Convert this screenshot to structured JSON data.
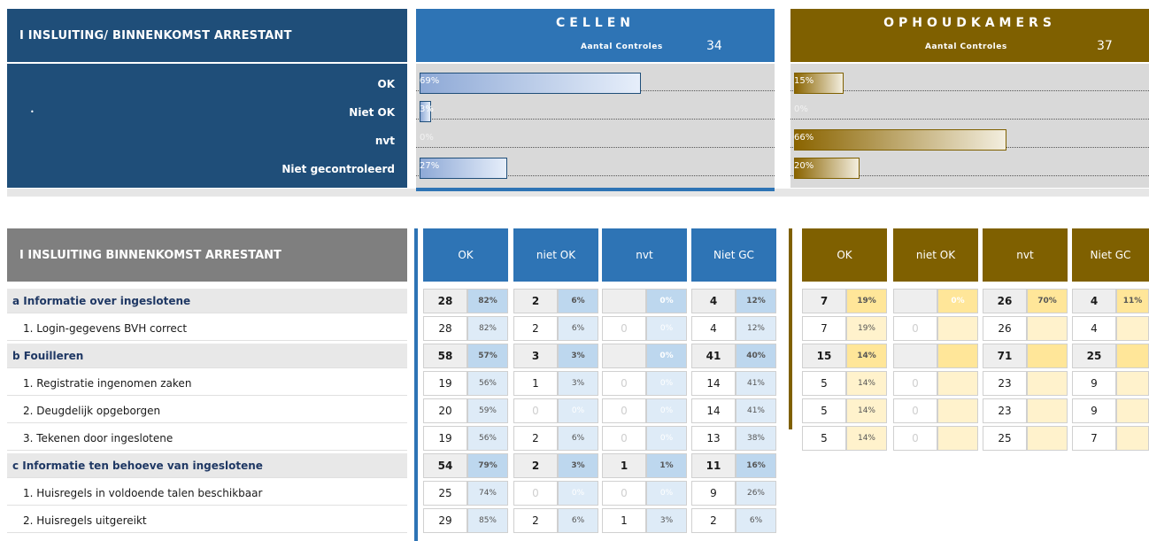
{
  "summary": {
    "title": "I   INSLUITING/ BINNENKOMST ARRESTANT",
    "rows": [
      "OK",
      "Niet OK",
      "nvt",
      "Niet gecontroleerd"
    ],
    "cellen": {
      "name": "CELLEN",
      "count_label": "Aantal Controles",
      "count": "34",
      "color": "#2e74b5",
      "values": [
        0.69,
        0.03,
        0.0,
        0.27
      ],
      "labels": [
        "69%",
        "3%",
        "0%",
        "27%"
      ]
    },
    "ophoudkamers": {
      "name": "OPHOUDKAMERS",
      "count_label": "Aantal Controles",
      "count": "37",
      "color": "#7f6000",
      "values": [
        0.15,
        0.0,
        0.66,
        0.2
      ],
      "labels": [
        "15%",
        "0%",
        "66%",
        "20%"
      ]
    }
  },
  "detail": {
    "title": "I   INSLUITING BINNENKOMST ARRESTANT",
    "cellen_headers": [
      "OK",
      "niet OK",
      "nvt",
      "Niet GC"
    ],
    "ophoud_headers": [
      "OK",
      "niet OK",
      "nvt",
      "Niet GC"
    ],
    "rows": [
      {
        "label": "a Informatie over ingeslotene",
        "cat": true,
        "c": [
          [
            "28",
            "82%"
          ],
          [
            "2",
            "6%"
          ],
          [
            "",
            "0%"
          ],
          [
            "4",
            "12%"
          ]
        ],
        "o": [
          [
            "7",
            "19%"
          ],
          [
            "",
            "0%"
          ],
          [
            "26",
            "70%"
          ],
          [
            "4",
            "11%"
          ]
        ]
      },
      {
        "label": "1. Login-gegevens BVH correct",
        "cat": false,
        "c": [
          [
            "28",
            "82%"
          ],
          [
            "2",
            "6%"
          ],
          [
            "0",
            "0%"
          ],
          [
            "4",
            "12%"
          ]
        ],
        "o": [
          [
            "7",
            "19%"
          ],
          [
            "0",
            ""
          ],
          [
            "26",
            ""
          ],
          [
            "4",
            ""
          ]
        ]
      },
      {
        "label": "b Fouilleren",
        "cat": true,
        "c": [
          [
            "58",
            "57%"
          ],
          [
            "3",
            "3%"
          ],
          [
            "",
            "0%"
          ],
          [
            "41",
            "40%"
          ]
        ],
        "o": [
          [
            "15",
            "14%"
          ],
          [
            "",
            ""
          ],
          [
            "71",
            ""
          ],
          [
            "25",
            ""
          ]
        ]
      },
      {
        "label": "1. Registratie ingenomen zaken",
        "cat": false,
        "c": [
          [
            "19",
            "56%"
          ],
          [
            "1",
            "3%"
          ],
          [
            "0",
            "0%"
          ],
          [
            "14",
            "41%"
          ]
        ],
        "o": [
          [
            "5",
            "14%"
          ],
          [
            "0",
            ""
          ],
          [
            "23",
            ""
          ],
          [
            "9",
            ""
          ]
        ]
      },
      {
        "label": "2. Deugdelijk opgeborgen",
        "cat": false,
        "c": [
          [
            "20",
            "59%"
          ],
          [
            "0",
            "0%"
          ],
          [
            "0",
            "0%"
          ],
          [
            "14",
            "41%"
          ]
        ],
        "o": [
          [
            "5",
            "14%"
          ],
          [
            "0",
            ""
          ],
          [
            "23",
            ""
          ],
          [
            "9",
            ""
          ]
        ]
      },
      {
        "label": "3. Tekenen door ingeslotene",
        "cat": false,
        "c": [
          [
            "19",
            "56%"
          ],
          [
            "2",
            "6%"
          ],
          [
            "0",
            "0%"
          ],
          [
            "13",
            "38%"
          ]
        ],
        "o": [
          [
            "5",
            "14%"
          ],
          [
            "0",
            ""
          ],
          [
            "25",
            ""
          ],
          [
            "7",
            ""
          ]
        ]
      },
      {
        "label": "c Informatie ten behoeve van ingeslotene",
        "cat": true,
        "c": [
          [
            "54",
            "79%"
          ],
          [
            "2",
            "3%"
          ],
          [
            "1",
            "1%"
          ],
          [
            "11",
            "16%"
          ]
        ],
        "o": null
      },
      {
        "label": "1. Huisregels in voldoende talen beschikbaar",
        "cat": false,
        "c": [
          [
            "25",
            "74%"
          ],
          [
            "0",
            "0%"
          ],
          [
            "0",
            "0%"
          ],
          [
            "9",
            "26%"
          ]
        ],
        "o": null
      },
      {
        "label": "2. Huisregels uitgereikt",
        "cat": false,
        "c": [
          [
            "29",
            "85%"
          ],
          [
            "2",
            "6%"
          ],
          [
            "1",
            "3%"
          ],
          [
            "2",
            "6%"
          ]
        ],
        "o": null
      }
    ]
  },
  "colors": {
    "blue": "#2e74b5",
    "dark_blue": "#1f4e79",
    "brown": "#7f6000",
    "pct_blue": "#bdd7ee",
    "pct_yellow": "#ffe699"
  }
}
